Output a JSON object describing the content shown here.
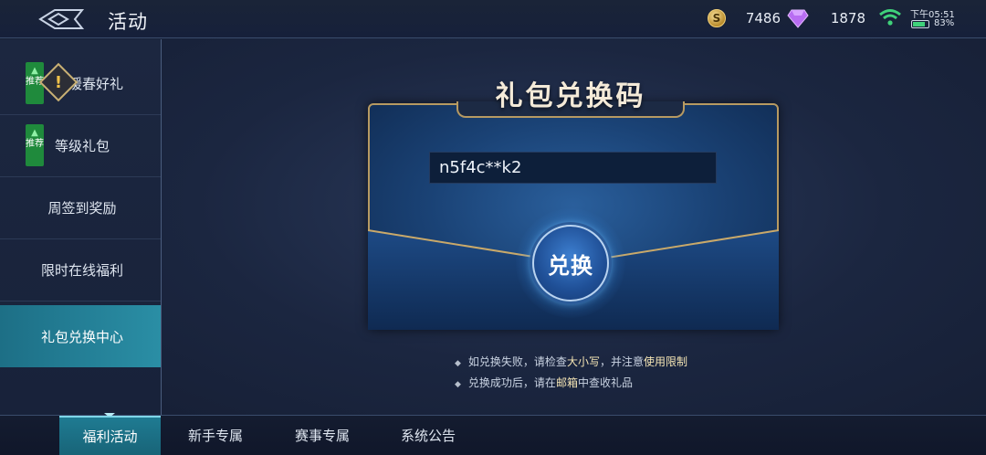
{
  "header": {
    "title": "活动",
    "coins": "7486",
    "coin_icon_symbol": "S",
    "gems": "1878",
    "status_time": "下午05:51",
    "battery": "83%",
    "battery_level": 0.83
  },
  "sidebar": {
    "recommend_badge": "推荐",
    "alert_symbol": "!",
    "items": [
      {
        "label": "暖春好礼"
      },
      {
        "label": "等级礼包"
      },
      {
        "label": "周签到奖励"
      },
      {
        "label": "限时在线福利"
      },
      {
        "label": "礼包兑换中心"
      }
    ]
  },
  "gift_code": {
    "title": "礼包兑换码",
    "code_value": "n5f4c**k2",
    "redeem_label": "兑换",
    "tips": [
      {
        "pre": "如兑换失败，请检查",
        "hl1": "大小写",
        "mid": "，并注意",
        "hl2": "使用限制",
        "post": ""
      },
      {
        "pre": "兑换成功后，请在",
        "hl1": "邮箱",
        "mid": "中查收礼品",
        "hl2": "",
        "post": ""
      }
    ]
  },
  "bottom_tabs": [
    {
      "label": "福利活动"
    },
    {
      "label": "新手专属"
    },
    {
      "label": "赛事专属"
    },
    {
      "label": "系统公告"
    }
  ],
  "colors": {
    "accent_teal": "#2a8ea5",
    "gold_border": "#b79a62",
    "recommend_green": "#1f8a3c"
  }
}
